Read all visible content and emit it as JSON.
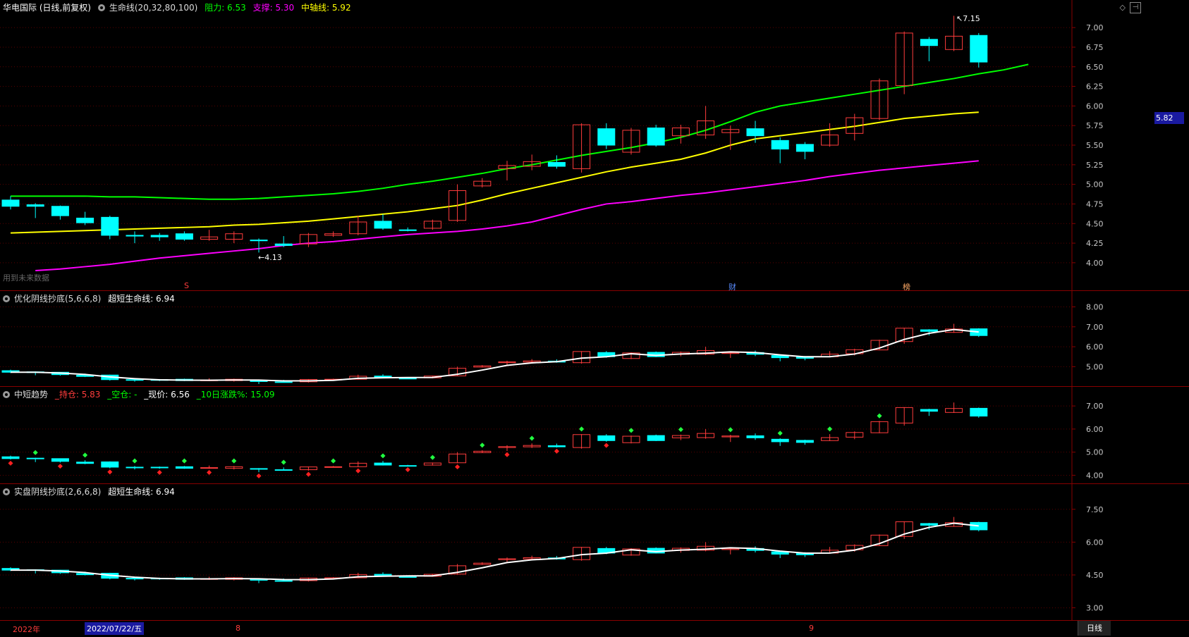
{
  "main_header": {
    "title": "华电国际 (日线,前复权)",
    "indicator_name": "生命线(20,32,80,100)",
    "resistance_label": "阻力: 6.53",
    "support_label": "支撑: 5.30",
    "midline_label": "中轴线: 5.92"
  },
  "main_annotations": {
    "high_label": "7.15",
    "low_label": "4.13",
    "current_price_box": "5.82",
    "future_data_note": "用到未来数据",
    "marker_s": "S",
    "marker_cai": "财",
    "marker_bang": "榜"
  },
  "main_yaxis": [
    "7.00",
    "6.75",
    "6.50",
    "6.25",
    "6.00",
    "5.75",
    "5.50",
    "5.25",
    "5.00",
    "4.75",
    "4.50",
    "4.25",
    "4.00"
  ],
  "pane2": {
    "header_name": "优化阴线抄底(5,6,6,8)",
    "header_value": "超短生命线: 6.94",
    "yaxis": [
      "8.00",
      "7.00",
      "6.00",
      "5.00"
    ]
  },
  "pane3": {
    "header_name": "中短趋势",
    "hold": "_持仓: 5.83",
    "empty": "_空仓: -",
    "price": "_现价: 6.56",
    "change": "_10日涨跌%: 15.09",
    "yaxis": [
      "7.00",
      "6.00",
      "5.00",
      "4.00"
    ]
  },
  "pane4": {
    "header_name": "实盘阴线抄底(2,6,6,8)",
    "header_value": "超短生命线: 6.94",
    "yaxis": [
      "7.50",
      "6.00",
      "4.50",
      "3.00"
    ]
  },
  "datebar": {
    "year": "2022年",
    "cursor_date": "2022/07/22/五",
    "month8": "8",
    "month9": "9",
    "period": "日线"
  },
  "colors": {
    "up": "#ff3c3c",
    "down": "#00ffff",
    "resistance": "#00ff00",
    "support": "#ff00ff",
    "midline": "#ffff00",
    "grid": "#5a0000"
  },
  "chart_data": {
    "type": "candlestick",
    "ylim": [
      3.9,
      7.2
    ],
    "candles": [
      {
        "o": 4.8,
        "c": 4.72,
        "h": 4.85,
        "l": 4.68
      },
      {
        "o": 4.74,
        "c": 4.72,
        "h": 4.76,
        "l": 4.57
      },
      {
        "o": 4.72,
        "c": 4.6,
        "h": 4.73,
        "l": 4.55
      },
      {
        "o": 4.57,
        "c": 4.51,
        "h": 4.65,
        "l": 4.48
      },
      {
        "o": 4.58,
        "c": 4.35,
        "h": 4.6,
        "l": 4.3
      },
      {
        "o": 4.35,
        "c": 4.34,
        "h": 4.4,
        "l": 4.25
      },
      {
        "o": 4.35,
        "c": 4.33,
        "h": 4.38,
        "l": 4.28
      },
      {
        "o": 4.37,
        "c": 4.3,
        "h": 4.4,
        "l": 4.28
      },
      {
        "o": 4.3,
        "c": 4.33,
        "h": 4.42,
        "l": 4.28
      },
      {
        "o": 4.3,
        "c": 4.37,
        "h": 4.4,
        "l": 4.25
      },
      {
        "o": 4.29,
        "c": 4.28,
        "h": 4.31,
        "l": 4.13
      },
      {
        "o": 4.24,
        "c": 4.22,
        "h": 4.34,
        "l": 4.2
      },
      {
        "o": 4.24,
        "c": 4.36,
        "h": 4.38,
        "l": 4.2
      },
      {
        "o": 4.35,
        "c": 4.37,
        "h": 4.4,
        "l": 4.33
      },
      {
        "o": 4.37,
        "c": 4.52,
        "h": 4.6,
        "l": 4.35
      },
      {
        "o": 4.53,
        "c": 4.44,
        "h": 4.62,
        "l": 4.42
      },
      {
        "o": 4.42,
        "c": 4.41,
        "h": 4.45,
        "l": 4.4
      },
      {
        "o": 4.44,
        "c": 4.53,
        "h": 4.55,
        "l": 4.42
      },
      {
        "o": 4.54,
        "c": 4.92,
        "h": 5.0,
        "l": 4.52
      },
      {
        "o": 4.98,
        "c": 5.04,
        "h": 5.08,
        "l": 4.96
      },
      {
        "o": 5.2,
        "c": 5.24,
        "h": 5.3,
        "l": 5.05
      },
      {
        "o": 5.23,
        "c": 5.29,
        "h": 5.38,
        "l": 5.18
      },
      {
        "o": 5.28,
        "c": 5.23,
        "h": 5.37,
        "l": 5.2
      },
      {
        "o": 5.2,
        "c": 5.76,
        "h": 5.78,
        "l": 5.15
      },
      {
        "o": 5.71,
        "c": 5.5,
        "h": 5.78,
        "l": 5.45
      },
      {
        "o": 5.41,
        "c": 5.69,
        "h": 5.72,
        "l": 5.38
      },
      {
        "o": 5.72,
        "c": 5.5,
        "h": 5.76,
        "l": 5.48
      },
      {
        "o": 5.62,
        "c": 5.72,
        "h": 5.76,
        "l": 5.52
      },
      {
        "o": 5.63,
        "c": 5.81,
        "h": 6.0,
        "l": 5.58
      },
      {
        "o": 5.66,
        "c": 5.7,
        "h": 5.75,
        "l": 5.44
      },
      {
        "o": 5.71,
        "c": 5.62,
        "h": 5.81,
        "l": 5.53
      },
      {
        "o": 5.56,
        "c": 5.45,
        "h": 5.6,
        "l": 5.27
      },
      {
        "o": 5.51,
        "c": 5.42,
        "h": 5.54,
        "l": 5.32
      },
      {
        "o": 5.5,
        "c": 5.63,
        "h": 5.78,
        "l": 5.48
      },
      {
        "o": 5.65,
        "c": 5.85,
        "h": 5.9,
        "l": 5.56
      },
      {
        "o": 5.84,
        "c": 6.32,
        "h": 6.35,
        "l": 5.82
      },
      {
        "o": 6.26,
        "c": 6.93,
        "h": 6.95,
        "l": 6.15
      },
      {
        "o": 6.85,
        "c": 6.77,
        "h": 6.88,
        "l": 6.57
      },
      {
        "o": 6.72,
        "c": 6.89,
        "h": 7.15,
        "l": 6.7
      },
      {
        "o": 6.9,
        "c": 6.56,
        "h": 6.93,
        "l": 6.49
      }
    ],
    "resistance_line": [
      4.85,
      4.85,
      4.85,
      4.85,
      4.84,
      4.84,
      4.83,
      4.82,
      4.81,
      4.81,
      4.82,
      4.84,
      4.86,
      4.88,
      4.91,
      4.95,
      5.0,
      5.04,
      5.09,
      5.14,
      5.2,
      5.25,
      5.31,
      5.37,
      5.42,
      5.47,
      5.53,
      5.6,
      5.69,
      5.8,
      5.92,
      6.0,
      6.05,
      6.1,
      6.15,
      6.2,
      6.25,
      6.3,
      6.35,
      6.41,
      6.46,
      6.53
    ],
    "midline": [
      4.38,
      4.39,
      4.4,
      4.41,
      4.42,
      4.43,
      4.44,
      4.45,
      4.46,
      4.48,
      4.49,
      4.51,
      4.53,
      4.56,
      4.59,
      4.62,
      4.65,
      4.69,
      4.73,
      4.8,
      4.88,
      4.95,
      5.02,
      5.09,
      5.16,
      5.22,
      5.27,
      5.32,
      5.4,
      5.5,
      5.58,
      5.62,
      5.66,
      5.7,
      5.74,
      5.79,
      5.84,
      5.87,
      5.9,
      5.92
    ],
    "support_line": [
      3.9,
      3.92,
      3.95,
      3.98,
      4.02,
      4.06,
      4.09,
      4.12,
      4.15,
      4.18,
      4.22,
      4.25,
      4.27,
      4.3,
      4.33,
      4.36,
      4.38,
      4.4,
      4.43,
      4.47,
      4.52,
      4.6,
      4.68,
      4.75,
      4.78,
      4.82,
      4.86,
      4.89,
      4.93,
      4.97,
      5.01,
      5.05,
      5.1,
      5.14,
      5.18,
      5.21,
      5.24,
      5.27,
      5.3
    ]
  }
}
